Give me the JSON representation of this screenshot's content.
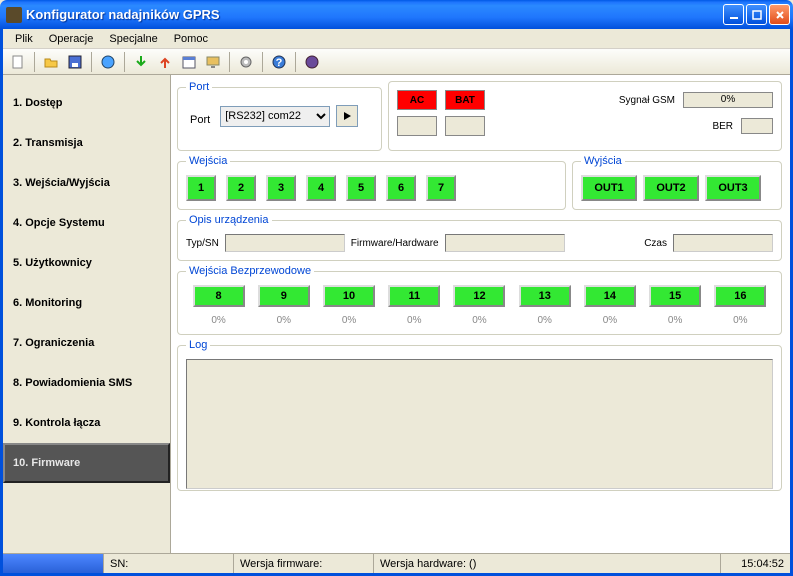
{
  "window": {
    "title": "Konfigurator nadajników GPRS"
  },
  "menu": {
    "plik": "Plik",
    "operacje": "Operacje",
    "specjalne": "Specjalne",
    "pomoc": "Pomoc"
  },
  "sidebar": {
    "items": [
      {
        "label": "1. Dostęp"
      },
      {
        "label": "2. Transmisja"
      },
      {
        "label": "3. Wejścia/Wyjścia"
      },
      {
        "label": "4. Opcje Systemu"
      },
      {
        "label": "5. Użytkownicy"
      },
      {
        "label": "6. Monitoring"
      },
      {
        "label": "7. Ograniczenia"
      },
      {
        "label": "8. Powiadomienia SMS"
      },
      {
        "label": "9. Kontrola łącza"
      },
      {
        "label": "10. Firmware"
      }
    ],
    "active_index": 9
  },
  "port": {
    "legend": "Port",
    "label": "Port",
    "value": "[RS232] com22"
  },
  "status": {
    "ac": "AC",
    "bat": "BAT",
    "sygnal_label": "Sygnał GSM",
    "sygnal_value": "0%",
    "ber_label": "BER"
  },
  "wejscia": {
    "legend": "Wejścia",
    "items": [
      "1",
      "2",
      "3",
      "4",
      "5",
      "6",
      "7"
    ]
  },
  "wyjscia": {
    "legend": "Wyjścia",
    "items": [
      "OUT1",
      "OUT2",
      "OUT3"
    ]
  },
  "opis": {
    "legend": "Opis urządzenia",
    "typsn_label": "Typ/SN",
    "typsn_value": "",
    "fw_label": "Firmware/Hardware",
    "fw_value": "",
    "czas_label": "Czas",
    "czas_value": ""
  },
  "wireless": {
    "legend": "Wejścia Bezprzewodowe",
    "items": [
      {
        "n": "8",
        "p": "0%"
      },
      {
        "n": "9",
        "p": "0%"
      },
      {
        "n": "10",
        "p": "0%"
      },
      {
        "n": "11",
        "p": "0%"
      },
      {
        "n": "12",
        "p": "0%"
      },
      {
        "n": "13",
        "p": "0%"
      },
      {
        "n": "14",
        "p": "0%"
      },
      {
        "n": "15",
        "p": "0%"
      },
      {
        "n": "16",
        "p": "0%"
      }
    ]
  },
  "log": {
    "legend": "Log"
  },
  "statusbar": {
    "sn": "SN:",
    "wf": "Wersja firmware:",
    "wh": "Wersja hardware: ()",
    "time": "15:04:52"
  }
}
